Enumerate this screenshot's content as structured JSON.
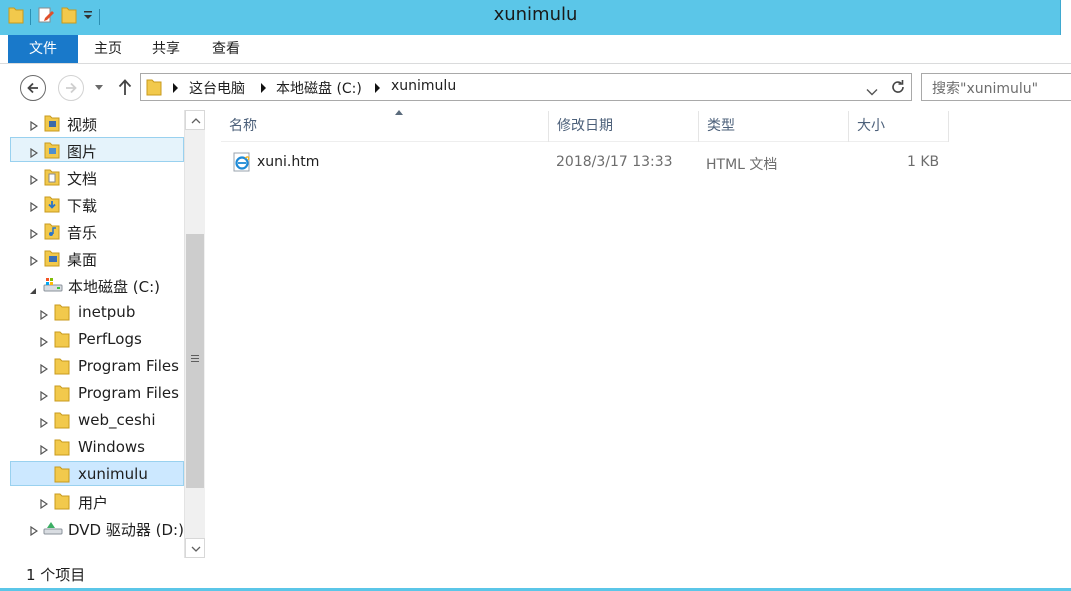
{
  "window": {
    "title": "xunimulu",
    "accent_color": "#5bc6e8"
  },
  "ribbon": {
    "tabs": [
      {
        "label": "文件"
      },
      {
        "label": "主页"
      },
      {
        "label": "共享"
      },
      {
        "label": "查看"
      }
    ]
  },
  "address": {
    "crumbs": [
      "这台电脑",
      "本地磁盘 (C:)",
      "xunimulu"
    ]
  },
  "search": {
    "placeholder": "搜索\"xunimulu\""
  },
  "nav_tree": {
    "items": [
      {
        "label": "视频",
        "icon": "video-folder-icon"
      },
      {
        "label": "图片",
        "icon": "pictures-folder-icon"
      },
      {
        "label": "文档",
        "icon": "documents-folder-icon"
      },
      {
        "label": "下载",
        "icon": "downloads-folder-icon"
      },
      {
        "label": "音乐",
        "icon": "music-folder-icon"
      },
      {
        "label": "桌面",
        "icon": "desktop-folder-icon"
      },
      {
        "label": "本地磁盘 (C:)",
        "icon": "drive-icon"
      },
      {
        "label": "inetpub",
        "icon": "folder-icon"
      },
      {
        "label": "PerfLogs",
        "icon": "folder-icon"
      },
      {
        "label": "Program Files",
        "icon": "folder-icon"
      },
      {
        "label": "Program Files (",
        "icon": "folder-icon"
      },
      {
        "label": "web_ceshi",
        "icon": "folder-icon"
      },
      {
        "label": "Windows",
        "icon": "folder-icon"
      },
      {
        "label": "xunimulu",
        "icon": "folder-icon"
      },
      {
        "label": "用户",
        "icon": "folder-icon"
      },
      {
        "label": "DVD 驱动器 (D:) I",
        "icon": "dvd-drive-icon"
      }
    ]
  },
  "file_list": {
    "columns": [
      "名称",
      "修改日期",
      "类型",
      "大小"
    ],
    "rows": [
      {
        "name": "xuni.htm",
        "modified": "2018/3/17 13:33",
        "type": "HTML 文档",
        "size": "1 KB",
        "icon": "ie-html-file-icon"
      }
    ]
  },
  "status": {
    "item_count": "1 个项目"
  }
}
